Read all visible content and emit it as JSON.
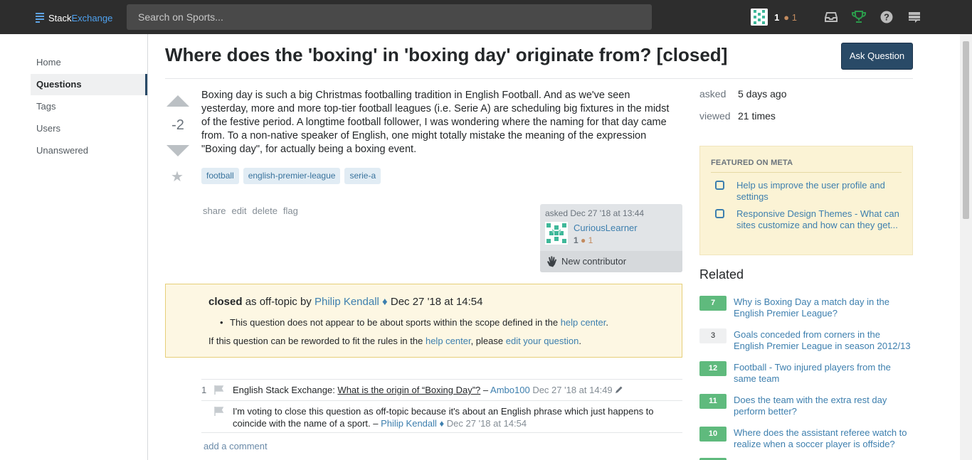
{
  "topbar": {
    "logo_part1": "Stack",
    "logo_part2": "Exchange",
    "search_placeholder": "Search on Sports...",
    "reputation": "1",
    "bronze_badges": "● 1"
  },
  "nav": {
    "items": [
      "Home",
      "Questions",
      "Tags",
      "Users",
      "Unanswered"
    ],
    "active": "Questions"
  },
  "question": {
    "title": "Where does the 'boxing' in 'boxing day' originate from? [closed]",
    "ask_button": "Ask Question",
    "score": "-2",
    "body": "Boxing day is such a big Christmas footballing tradition in English Football. And as we've seen yesterday, more and more top-tier football leagues (i.e. Serie A) are scheduling big fixtures in the midst of the festive period. A longtime football follower, I was wondering where the naming for that day came from. To a non-native speaker of English, one might totally mistake the meaning of the expression \"Boxing day\", for actually being a boxing event.",
    "tags": [
      "football",
      "english-premier-league",
      "serie-a"
    ],
    "menu": [
      "share",
      "edit",
      "delete",
      "flag"
    ],
    "owner": {
      "asked": "asked Dec 27 '18 at 13:44",
      "name": "CuriousLearner",
      "rep": "1",
      "bronze": "● 1",
      "new_contributor": "New contributor"
    }
  },
  "closed_notice": {
    "label": "closed",
    "as_text": " as off-topic by ",
    "moderator": "Philip Kendall ♦",
    "date": " Dec 27 '18 at 14:54",
    "reason_text": "This question does not appear to be about sports within the scope defined in the ",
    "reason_link": "help center",
    "reason_end": ".",
    "foot_text1": "If this question can be reworded to fit the rules in the ",
    "foot_link1": "help center",
    "foot_text2": ", please ",
    "foot_link2": "edit your question",
    "foot_end": "."
  },
  "comments": [
    {
      "score": "1",
      "prefix": "English Stack Exchange: ",
      "link": "What is the origin of “Boxing Day”?",
      "sep": " – ",
      "user": "Ambo100",
      "date": " Dec 27 '18 at 14:49"
    },
    {
      "text": "I'm voting to close this question as off-topic because it's about an English phrase which just happens to coincide with the name of a sport.",
      "sep": " – ",
      "user": "Philip Kendall ♦",
      "date": " Dec 27 '18 at 14:54"
    }
  ],
  "add_comment": "add a comment",
  "sidebar": {
    "asked_label": "asked",
    "asked_value": "5 days ago",
    "viewed_label": "viewed",
    "viewed_value": "21 times",
    "featured_title": "FEATURED ON META",
    "featured": [
      "Help us improve the user profile and settings",
      "Responsive Design Themes - What can sites customize and how can they get..."
    ],
    "related_title": "Related",
    "related": [
      {
        "score": "7",
        "title": "Why is Boxing Day a match day in the English Premier League?"
      },
      {
        "score": "3",
        "title": "Goals conceded from corners in the English Premier League in season 2012/13"
      },
      {
        "score": "12",
        "title": "Football - Two injured players from the same team"
      },
      {
        "score": "11",
        "title": "Does the team with the extra rest day perform better?"
      },
      {
        "score": "10",
        "title": "Where does the assistant referee watch to realize when a soccer player is offside?"
      }
    ]
  },
  "colors": {
    "topbar": "#2d2d2d",
    "accent": "#294a67",
    "link": "#3d7fae",
    "answered_green": "#5fba7d",
    "closed_bg": "#fdf7e3"
  }
}
